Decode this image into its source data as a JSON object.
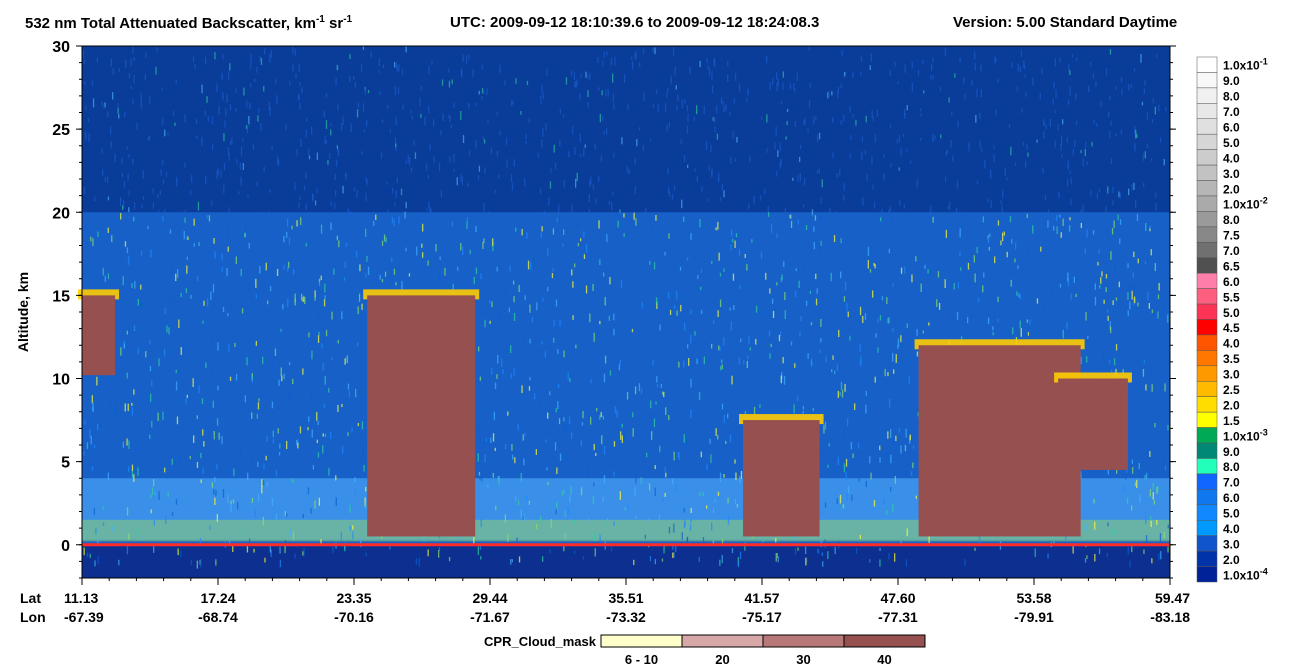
{
  "title": {
    "product": "532 nm Total Attenuated Backscatter, km",
    "unit_exp1": "-1",
    "unit_sr": " sr",
    "unit_exp2": "-1",
    "utc": "UTC:  2009-09-12 18:10:39.6  to  2009-09-12 18:24:08.3",
    "version": "Version: 5.00  Standard  Daytime"
  },
  "chart_data": {
    "type": "heatmap",
    "title": "532 nm Total Attenuated Backscatter, km-1 sr-1",
    "ylabel": "Altitude, km",
    "ylim": [
      -2,
      30
    ],
    "yticks": [
      "30",
      "25",
      "20",
      "15",
      "10",
      "5",
      "0"
    ],
    "ytick_values": [
      30,
      25,
      20,
      15,
      10,
      5,
      0
    ],
    "x_row_labels": [
      "Lat",
      "Lon"
    ],
    "lat": [
      "11.13",
      "17.24",
      "23.35",
      "29.44",
      "35.51",
      "41.57",
      "47.60",
      "53.58",
      "59.47"
    ],
    "lon": [
      "-67.39",
      "-68.74",
      "-70.16",
      "-71.67",
      "-73.32",
      "-75.17",
      "-77.31",
      "-79.91",
      "-83.18"
    ],
    "colorbar": {
      "labels": [
        "1.0x10-1",
        "9.0",
        "8.0",
        "7.0",
        "6.0",
        "5.0",
        "4.0",
        "3.0",
        "2.0",
        "1.0x10-2",
        "8.0",
        "7.5",
        "7.0",
        "6.5",
        "6.0",
        "5.5",
        "5.0",
        "4.5",
        "4.0",
        "3.5",
        "3.0",
        "2.5",
        "2.0",
        "1.5",
        "1.0x10-3",
        "9.0",
        "8.0",
        "7.0",
        "6.0",
        "5.0",
        "4.0",
        "3.0",
        "2.0",
        "1.0x10-4"
      ],
      "colors": [
        "#ffffff",
        "#f8f8f8",
        "#f0f0f0",
        "#e8e8e8",
        "#e0e0e0",
        "#d6d6d6",
        "#cccccc",
        "#c2c2c2",
        "#b6b6b6",
        "#aaaaaa",
        "#9a9a9a",
        "#888888",
        "#707070",
        "#505050",
        "#ff7faa",
        "#ff5f7f",
        "#ff3355",
        "#ff0000",
        "#ff5500",
        "#ff7700",
        "#ff9900",
        "#ffbb00",
        "#ffdd00",
        "#ffff00",
        "#00aa55",
        "#008877",
        "#22ffbb",
        "#1166ff",
        "#1177ee",
        "#1188ff",
        "#0099ff",
        "#1155cc",
        "#0033aa",
        "#002299"
      ]
    },
    "cloud_mask_legend": {
      "label": "CPR_Cloud_mask",
      "items": [
        {
          "label": "6 - 10",
          "color": "#ffffcc"
        },
        {
          "label": "20",
          "color": "#d8a8a8"
        },
        {
          "label": "30",
          "color": "#b87878"
        },
        {
          "label": "40",
          "color": "#965050"
        }
      ]
    },
    "cloud_features": [
      {
        "lat_range": [
          11.13,
          12.6
        ],
        "alt_range": [
          10.2,
          15.0
        ],
        "type": "cloud"
      },
      {
        "lat_range": [
          23.8,
          28.6
        ],
        "alt_range": [
          0.5,
          15.0
        ],
        "type": "cloud"
      },
      {
        "lat_range": [
          40.5,
          43.9
        ],
        "alt_range": [
          0.5,
          7.5
        ],
        "type": "cloud"
      },
      {
        "lat_range": [
          48.3,
          55.5
        ],
        "alt_range": [
          0.5,
          12.0
        ],
        "type": "cloud"
      },
      {
        "lat_range": [
          54.5,
          57.6
        ],
        "alt_range": [
          4.5,
          10.0
        ],
        "type": "cloud"
      }
    ],
    "surface_alt_km": 0
  }
}
